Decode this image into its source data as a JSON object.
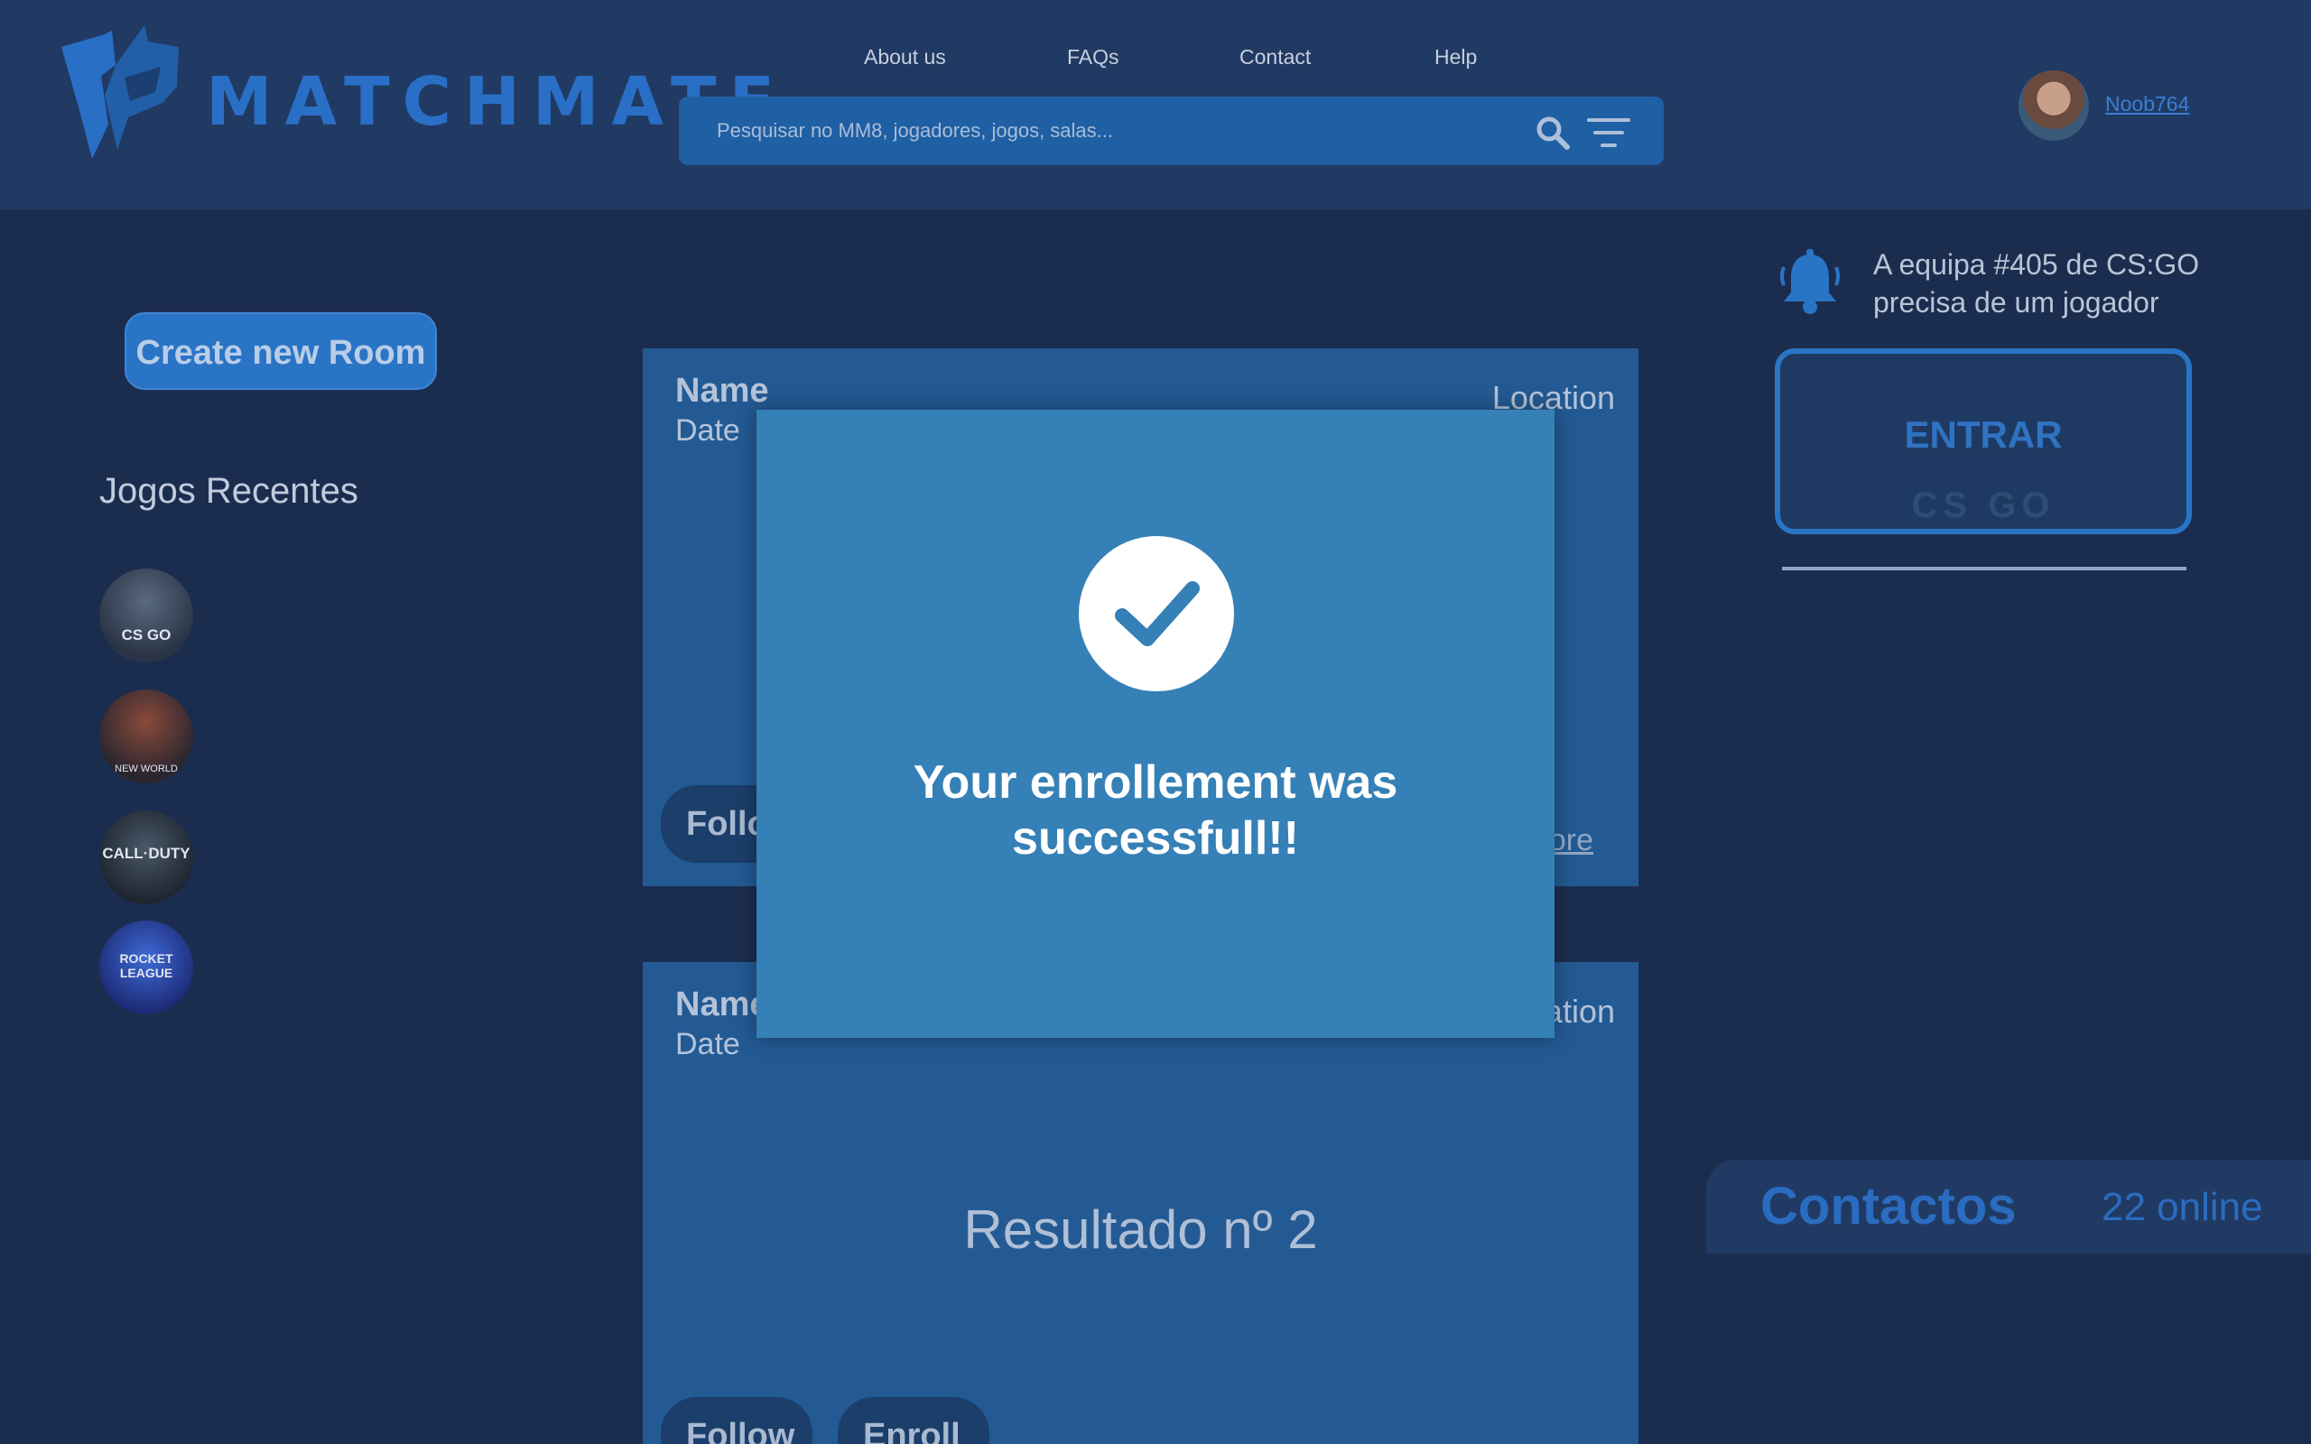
{
  "header": {
    "brand": "MATCHMATE",
    "nav": [
      "About us",
      "FAQs",
      "Contact",
      "Help"
    ],
    "search_placeholder": "Pesquisar no MM8, jogadores, jogos, salas...",
    "username": "Noob764"
  },
  "left": {
    "create_button": "Create new Room",
    "recent_title": "Jogos Recentes",
    "games": [
      {
        "label": "CS GO"
      },
      {
        "label": "NEW WORLD"
      },
      {
        "label": "CALL·DUTY"
      },
      {
        "label": "ROCKET LEAGUE"
      }
    ]
  },
  "cards": [
    {
      "name": "Name",
      "date": "Date",
      "location": "Location",
      "follow": "Follo",
      "more": "ore"
    },
    {
      "name": "Name",
      "date": "Date",
      "location": "ation",
      "result": "Resultado nº 2",
      "follow": "Follow",
      "enroll": "Enroll"
    }
  ],
  "right": {
    "notification": [
      "A equipa #405 de CS:GO",
      "precisa de um jogador"
    ],
    "entrar": "ENTRAR",
    "entrar_game": "CS GO",
    "contacts_title": "Contactos",
    "contacts_online": "22 online"
  },
  "modal": {
    "message_line1": "Your enrollement was",
    "message_line2": "successfull!!"
  },
  "colors": {
    "background": "#1b2d4f",
    "header": "#213a63",
    "accent": "#2a74c6",
    "modal": "#3580b6"
  }
}
